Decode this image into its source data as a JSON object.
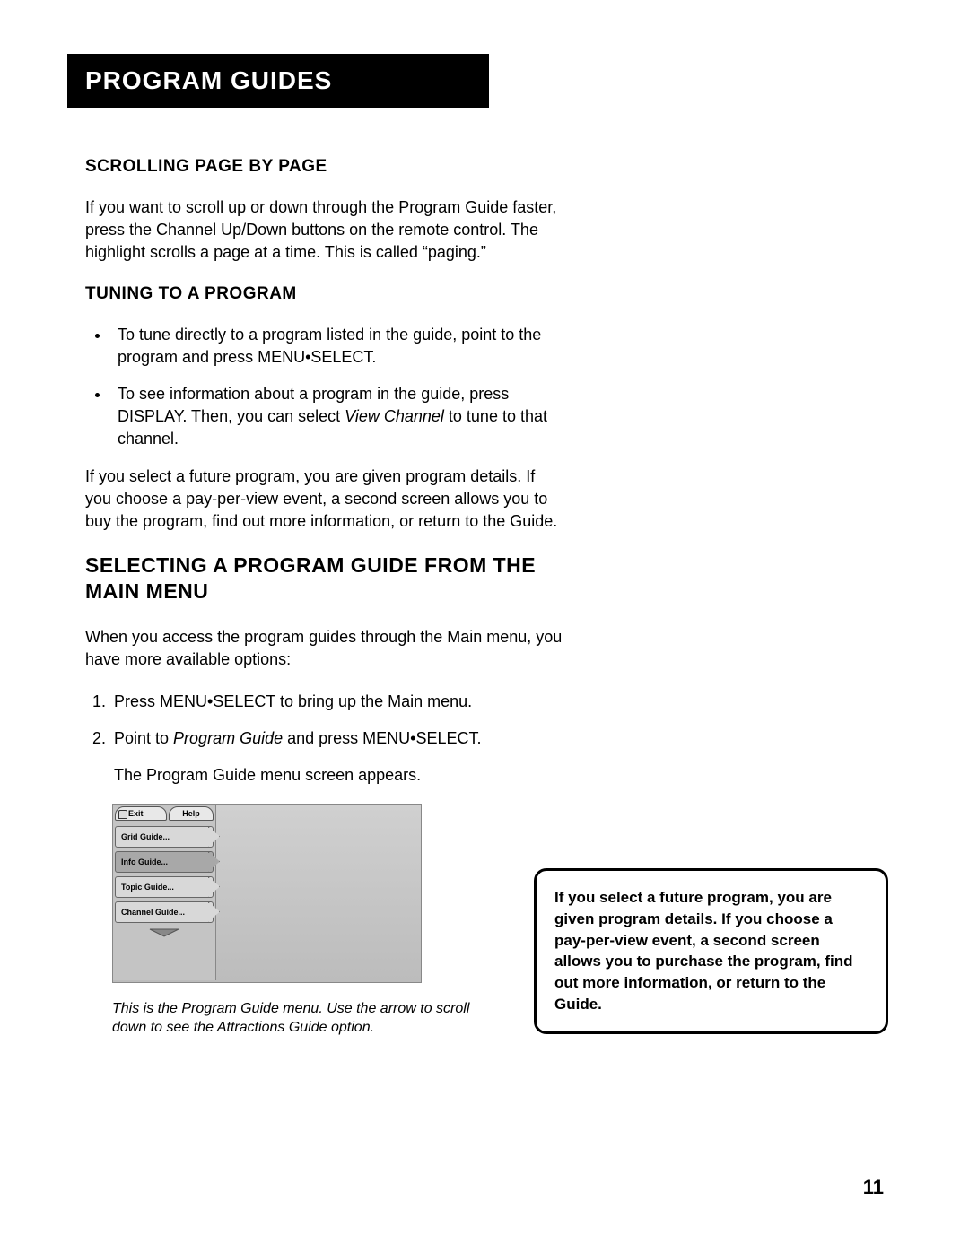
{
  "header": {
    "title": "Program Guides"
  },
  "sections": {
    "scrolling": {
      "heading": "Scrolling Page by Page",
      "body": "If you want to scroll up or down through the Program Guide faster, press the Channel Up/Down buttons on the remote control. The highlight scrolls a page at a time. This is called “paging.”"
    },
    "tuning": {
      "heading": "Tuning to a Program",
      "bullets": [
        {
          "pre": "To tune directly to a program listed in the guide, point to the program and press MENU•SELECT."
        },
        {
          "pre": "To see information about a program in the guide, press DISPLAY. Then, you can select ",
          "italic": "View Channel",
          "post": " to tune to that channel."
        }
      ],
      "after": "If you select a future program, you are given program details. If you choose a pay-per-view event, a second screen allows you to buy the program, find out more information, or return to the Guide."
    },
    "selecting": {
      "heading": "Selecting a Program Guide from the Main Menu",
      "intro": "When you access the program guides through the Main menu, you have more available options:",
      "steps": [
        {
          "text": "Press MENU•SELECT to bring up the Main menu."
        },
        {
          "pre": "Point to ",
          "italic": "Program Guide",
          "post": " and press MENU•SELECT."
        }
      ],
      "step_sub": "The Program Guide menu screen appears.",
      "caption": "This is the Program Guide menu. Use the arrow to scroll down to see the Attractions Guide option."
    }
  },
  "menu_screenshot": {
    "tabs": {
      "exit": "Exit",
      "help": "Help"
    },
    "items": [
      "Grid Guide...",
      "Info Guide...",
      "Topic Guide...",
      "Channel Guide..."
    ]
  },
  "sidebar": {
    "text": "If you select a future program, you are given program details. If you choose a pay-per-view event, a second screen allows you to purchase the program, find out more information, or return to the Guide."
  },
  "page_number": "11"
}
